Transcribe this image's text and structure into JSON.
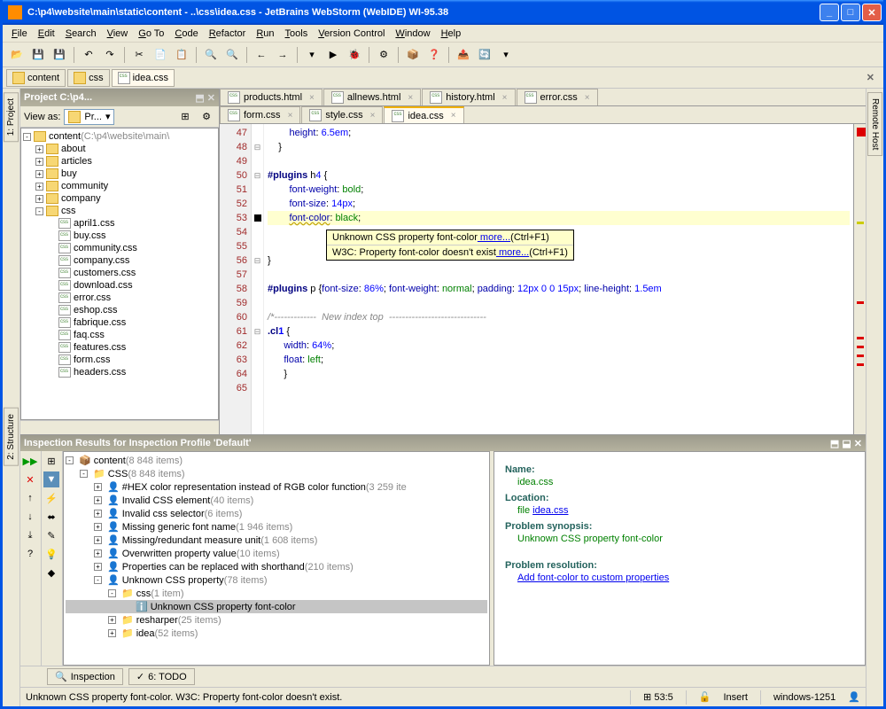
{
  "title": "C:\\p4\\website\\main\\static\\content - ..\\css\\idea.css - JetBrains WebStorm (WebIDE) WI-95.38",
  "menu": [
    "File",
    "Edit",
    "Search",
    "View",
    "Go To",
    "Code",
    "Refactor",
    "Run",
    "Tools",
    "Version Control",
    "Window",
    "Help"
  ],
  "breadcrumb": {
    "items": [
      "content",
      "css",
      "idea.css"
    ]
  },
  "left_tabs": [
    "1: Project",
    "2: Structure"
  ],
  "right_tabs": [
    "Remote Host"
  ],
  "project": {
    "header": "Project C:\\p4...",
    "view_as": "View as:",
    "view_combo": "Pr...",
    "root": "content",
    "root_path": "(C:\\p4\\website\\main\\",
    "folders": [
      "about",
      "articles",
      "buy",
      "community",
      "company",
      "css"
    ],
    "css_files": [
      "april1.css",
      "buy.css",
      "community.css",
      "company.css",
      "customers.css",
      "download.css",
      "error.css",
      "eshop.css",
      "fabrique.css",
      "faq.css",
      "features.css",
      "form.css",
      "headers.css"
    ]
  },
  "tabs_row1": [
    {
      "label": "products.html"
    },
    {
      "label": "allnews.html"
    },
    {
      "label": "history.html"
    },
    {
      "label": "error.css"
    }
  ],
  "tabs_row2": [
    {
      "label": "form.css"
    },
    {
      "label": "style.css"
    },
    {
      "label": "idea.css",
      "active": true
    }
  ],
  "code": {
    "start": 47,
    "lines": [
      {
        "n": 47,
        "txt": "        height: 6.5em;"
      },
      {
        "n": 48,
        "txt": "    }"
      },
      {
        "n": 49,
        "txt": ""
      },
      {
        "n": 50,
        "txt": "#plugins h4 {"
      },
      {
        "n": 51,
        "txt": "        font-weight: bold;"
      },
      {
        "n": 52,
        "txt": "        font-size: 14px;"
      },
      {
        "n": 53,
        "txt": "        font-color: black;",
        "hl": true
      },
      {
        "n": 54,
        "txt": "        "
      },
      {
        "n": 55,
        "txt": "        "
      },
      {
        "n": 56,
        "txt": "}"
      },
      {
        "n": 57,
        "txt": ""
      },
      {
        "n": 58,
        "txt": "#plugins p {font-size: 86%; font-weight: normal; padding: 12px 0 0 15px; line-height: 1.5em"
      },
      {
        "n": 59,
        "txt": ""
      },
      {
        "n": 60,
        "txt": "/*-------------  New index top  ------------------------------"
      },
      {
        "n": 61,
        "txt": ".cl1 {"
      },
      {
        "n": 62,
        "txt": "      width: 64%;"
      },
      {
        "n": 63,
        "txt": "      float: left;"
      },
      {
        "n": 64,
        "txt": "      }"
      },
      {
        "n": 65,
        "txt": ""
      }
    ]
  },
  "tooltip": {
    "line1_a": "Unknown CSS property font-color",
    "line1_more": " more...",
    "line1_b": "(Ctrl+F1)",
    "line2_a": "W3C: Property font-color doesn't exist",
    "line2_more": " more...",
    "line2_b": "(Ctrl+F1)"
  },
  "inspection": {
    "header": "Inspection Results for Inspection Profile 'Default'",
    "root": "content",
    "root_cnt": "(8 848 items)",
    "css": "CSS",
    "css_cnt": "(8 848 items)",
    "items": [
      {
        "label": "#HEX color representation instead of RGB color function",
        "cnt": "(3 259 ite"
      },
      {
        "label": "Invalid CSS element",
        "cnt": "(40 items)"
      },
      {
        "label": "Invalid css selector",
        "cnt": "(6 items)"
      },
      {
        "label": "Missing generic font name",
        "cnt": "(1 946 items)"
      },
      {
        "label": "Missing/redundant measure unit",
        "cnt": "(1 608 items)"
      },
      {
        "label": "Overwritten property value",
        "cnt": "(10 items)"
      },
      {
        "label": "Properties can be replaced with shorthand",
        "cnt": "(210 items)"
      },
      {
        "label": "Unknown CSS property",
        "cnt": "(78 items)"
      }
    ],
    "sub_css": "css",
    "sub_css_cnt": "(1 item)",
    "selected": "Unknown CSS property font-color",
    "resharper": "resharper",
    "resharper_cnt": "(25 items)",
    "idea": "idea",
    "idea_cnt": "(52 items)"
  },
  "detail": {
    "name_lbl": "Name:",
    "name": "idea.css",
    "loc_lbl": "Location:",
    "loc_prefix": "file ",
    "loc_link": "idea.css",
    "syn_lbl": "Problem synopsis:",
    "syn": "Unknown CSS property font-color",
    "res_lbl": "Problem resolution:",
    "res_link": "Add font-color to custom properties"
  },
  "bottom_tabs": {
    "inspection": "Inspection",
    "todo": "6: TODO"
  },
  "status": {
    "msg": "Unknown CSS property font-color. W3C: Property font-color doesn't exist.",
    "pos": "53:5",
    "insert": "Insert",
    "enc": "windows-1251"
  }
}
